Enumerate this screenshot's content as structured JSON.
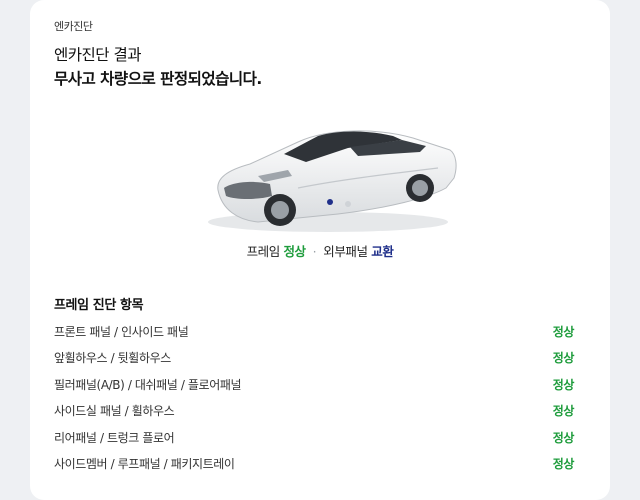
{
  "header": {
    "section_label": "엔카진단",
    "result_line1": "엔카진단 결과",
    "result_line2": "무사고 차량으로 판정되었습니다."
  },
  "summary": {
    "frame_label": "프레임",
    "frame_value": "정상",
    "separator": "·",
    "panel_label": "외부패널",
    "panel_value": "교환"
  },
  "items": {
    "title": "프레임 진단 항목",
    "rows": [
      {
        "label": "프론트 패널 / 인사이드 패널",
        "value": "정상"
      },
      {
        "label": "앞휠하우스 / 뒷휠하우스",
        "value": "정상"
      },
      {
        "label": "필러패널(A/B) / 대쉬패널 / 플로어패널",
        "value": "정상"
      },
      {
        "label": "사이드실 패널 / 휠하우스",
        "value": "정상"
      },
      {
        "label": "리어패널 / 트렁크 플로어",
        "value": "정상"
      },
      {
        "label": "사이드멤버 / 루프패널 / 패키지트레이",
        "value": "정상"
      }
    ]
  },
  "colors": {
    "ok": "#1e9c3c",
    "exchange": "#1f2f8a",
    "background": "#eef0f3",
    "card": "#ffffff"
  }
}
